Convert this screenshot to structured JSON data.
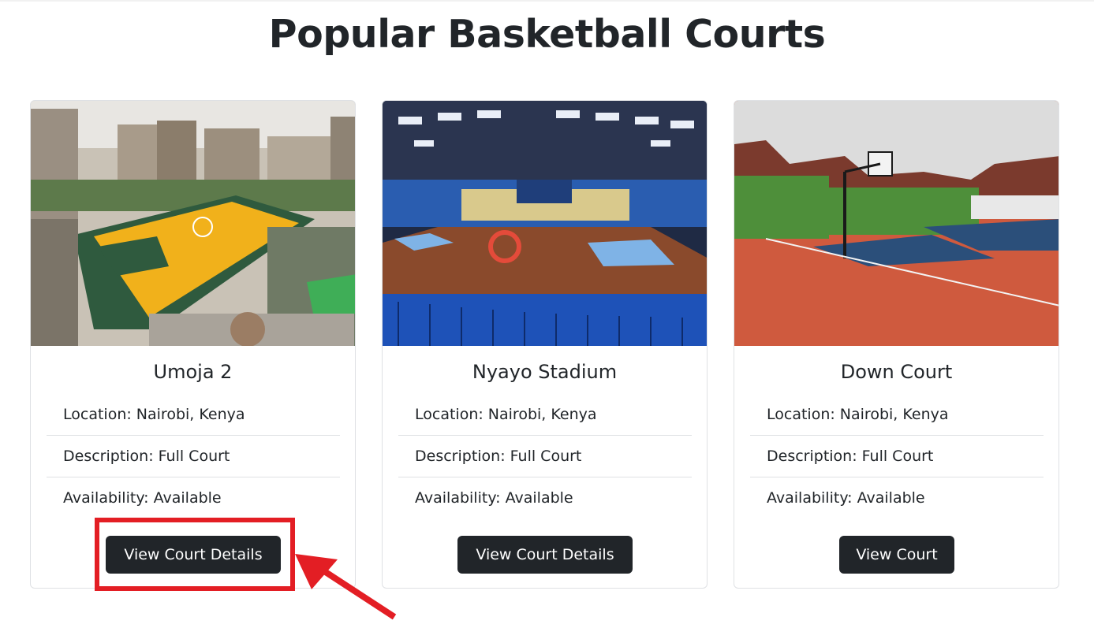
{
  "page": {
    "title": "Popular Basketball Courts"
  },
  "courts": [
    {
      "name": "Umoja 2",
      "location": "Location: Nairobi, Kenya",
      "description": "Description: Full Court",
      "availability": "Availability: Available",
      "button_label": "View Court Details",
      "image": "outdoor-yellow-court-photo"
    },
    {
      "name": "Nyayo Stadium",
      "location": "Location: Nairobi, Kenya",
      "description": "Description: Full Court",
      "availability": "Availability: Available",
      "button_label": "View Court Details",
      "image": "indoor-stadium-court-photo"
    },
    {
      "name": "Down Court",
      "location": "Location: Nairobi, Kenya",
      "description": "Description: Full Court",
      "availability": "Availability: Available",
      "button_label": "View Court",
      "image": "outdoor-red-blue-court-photo"
    }
  ],
  "annotation": {
    "color": "#e31e24"
  },
  "colors": {
    "button_bg": "#212529",
    "button_text": "#ffffff",
    "border": "#dfe1e4"
  }
}
